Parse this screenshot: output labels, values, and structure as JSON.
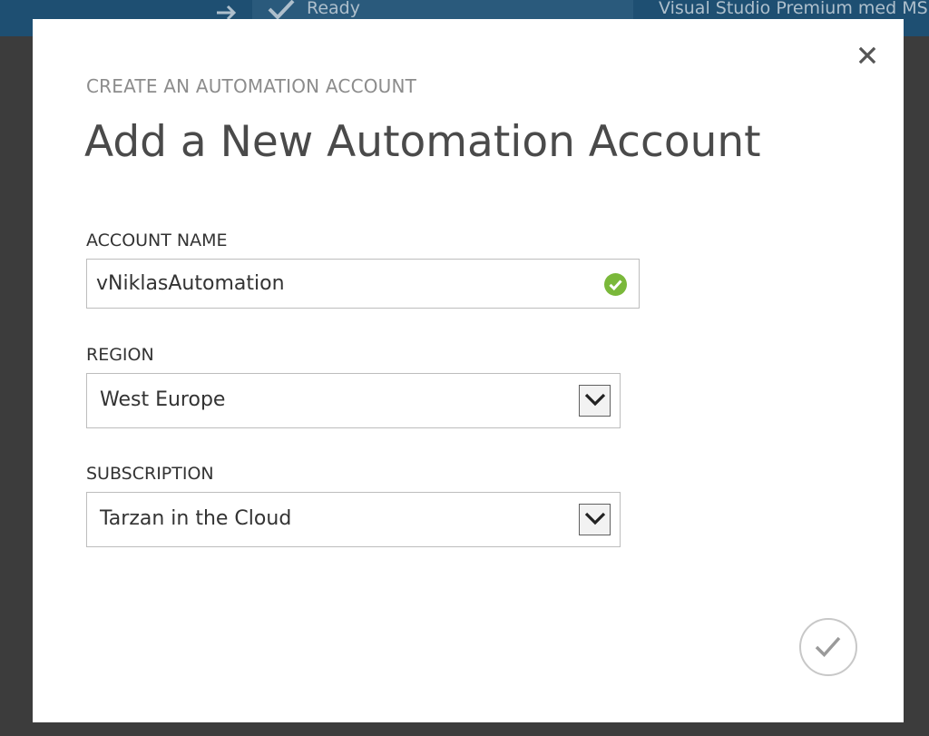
{
  "background_window": {
    "status_text": "Ready",
    "subscription_text": "Visual Studio Premium med MSDN"
  },
  "dialog": {
    "eyebrow": "CREATE AN AUTOMATION ACCOUNT",
    "title": "Add a New Automation Account",
    "fields": {
      "account_name": {
        "label": "ACCOUNT NAME",
        "value": "vNiklasAutomation",
        "valid": true
      },
      "region": {
        "label": "REGION",
        "selected": "West Europe"
      },
      "subscription": {
        "label": "SUBSCRIPTION",
        "selected": "Tarzan in the Cloud"
      }
    },
    "icons": {
      "close": "close-icon",
      "valid": "checkmark-circle-icon",
      "dropdown": "chevron-down-icon",
      "confirm": "checkmark-icon"
    }
  },
  "colors": {
    "topbar": "#1e4f72",
    "overlay": "#3c3c3c",
    "valid_green": "#7ab83a",
    "title_gray": "#4a4a4a"
  }
}
